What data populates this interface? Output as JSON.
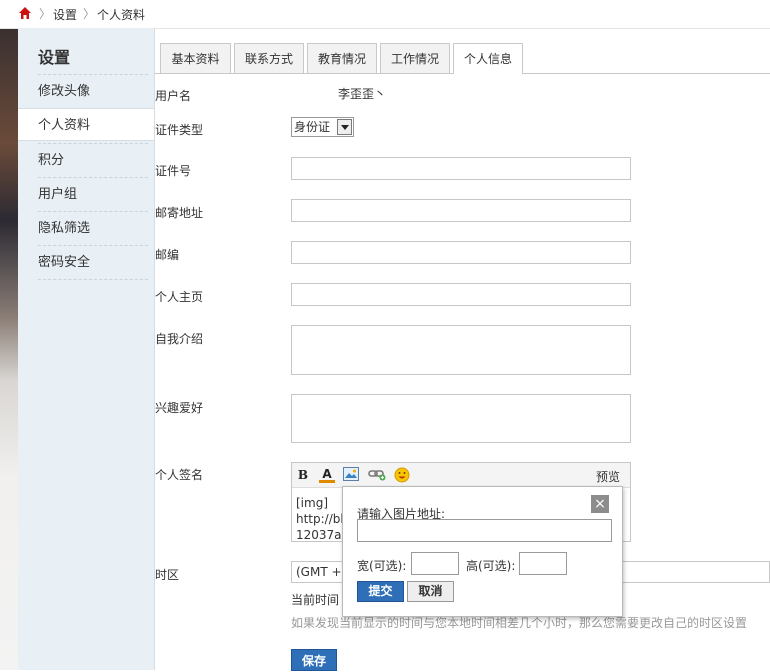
{
  "breadcrumb": {
    "home_icon": "home-icon",
    "items": [
      "设置",
      "个人资料"
    ]
  },
  "sidebar": {
    "title": "设置",
    "items": [
      {
        "label": "修改头像"
      },
      {
        "label": "个人资料",
        "active": true
      },
      {
        "label": "积分"
      },
      {
        "label": "用户组"
      },
      {
        "label": "隐私筛选"
      },
      {
        "label": "密码安全"
      }
    ]
  },
  "tabs": [
    {
      "label": "基本资料"
    },
    {
      "label": "联系方式"
    },
    {
      "label": "教育情况"
    },
    {
      "label": "工作情况"
    },
    {
      "label": "个人信息",
      "active": true
    }
  ],
  "form": {
    "username_label": "用户名",
    "username_value": "李歪歪丶",
    "id_type_label": "证件类型",
    "id_type_value": "身份证",
    "id_number_label": "证件号",
    "address_label": "邮寄地址",
    "zip_label": "邮编",
    "homepage_label": "个人主页",
    "bio_label": "自我介绍",
    "hobby_label": "兴趣爱好",
    "signature_label": "个人签名",
    "signature_text": "[img]\nhttp://bb\n12037a5",
    "preview_label": "预览",
    "timezone_label": "时区",
    "timezone_value": "(GMT +0",
    "current_time_label": "当前时间",
    "hint": "如果发现当前显示的时间与您本地时间相差几个小时，那么您需要更改自己的时区设置",
    "save_label": "保存"
  },
  "editor_toolbar": {
    "bold": "B",
    "color": "A",
    "icons": [
      "bold-icon",
      "font-color-icon",
      "image-icon",
      "link-icon",
      "smiley-icon"
    ]
  },
  "popup": {
    "url_label": "请输入图片地址:",
    "width_label": "宽(可选):",
    "height_label": "高(可选):",
    "submit_label": "提交",
    "cancel_label": "取消",
    "close_label": "×"
  },
  "colors": {
    "accent": "#2e6fb7",
    "sidebar_bg": "#e8eff5",
    "home_icon": "#cc1111"
  }
}
